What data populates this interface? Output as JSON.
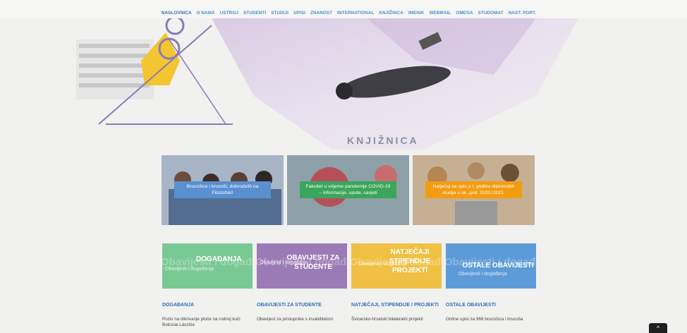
{
  "nav": {
    "items": [
      "NASLOVNICA",
      "O NAMA",
      "USTROJ",
      "STUDENTI",
      "STUDIJI",
      "UPISI",
      "ZNANOST",
      "INTERNATIONAL",
      "KNJIŽNICA",
      "IMENIK",
      "WEBMAIL",
      "OMEGA",
      "STUDOMAT",
      "NAST. PORT."
    ]
  },
  "hero": {
    "title": "KNJIŽNICA"
  },
  "slides": [
    {
      "caption": "Brucošice i brucoši, dobrodošli na Filozofski!",
      "color": "#5a8fd0"
    },
    {
      "caption": "Fakultet u vrijeme pandemije COVID-19 – informacije, upute, savjeti",
      "color": "#3aa65b"
    },
    {
      "caption": "Natječaj za upis u I. godinu diplomskih studija u ak. god. 2020./2021.",
      "color": "#f39c12"
    }
  ],
  "categories": [
    {
      "title": "DOGAĐANJA",
      "sub": "Obavijesti i događanja",
      "watermark": "Obavijesti i događanja",
      "color": "#79c993"
    },
    {
      "title": "OBAVIJESTI ZA STUDENTE",
      "sub": "Obavijesti i događanja",
      "watermark": "Obavijesti i događanja",
      "color": "#9b7ab5"
    },
    {
      "title": "NATJEČAJI STIPENDIJE PROJEKTI",
      "sub": "Obavijesti i događanja",
      "watermark": "Obavijesti i događanja",
      "color": "#efc043"
    },
    {
      "title": "OSTALE OBAVIJESTI",
      "sub": "Obavijesti i događanja",
      "watermark": "Obavijesti i događanja",
      "color": "#5d9bd8"
    }
  ],
  "columns": [
    {
      "head": "DOGAĐANJA",
      "item": "Poziv na otkrivanje ploče na rodnoj kući Bulcsúa Lászlóa"
    },
    {
      "head": "OBAVIJESTI ZA STUDENTE",
      "item": "Obavijest za pristupnike s invaliditetom"
    },
    {
      "head": "NATJEČAJI, STIPENDIJE I PROJEKTI",
      "item": "Švicarsko-hrvatski bilateralni projekti"
    },
    {
      "head": "OSTALE OBAVIJESTI",
      "item": "Online upisi za 966 brucošica i brucoša"
    }
  ],
  "ui": {
    "scroll_top": "^"
  }
}
